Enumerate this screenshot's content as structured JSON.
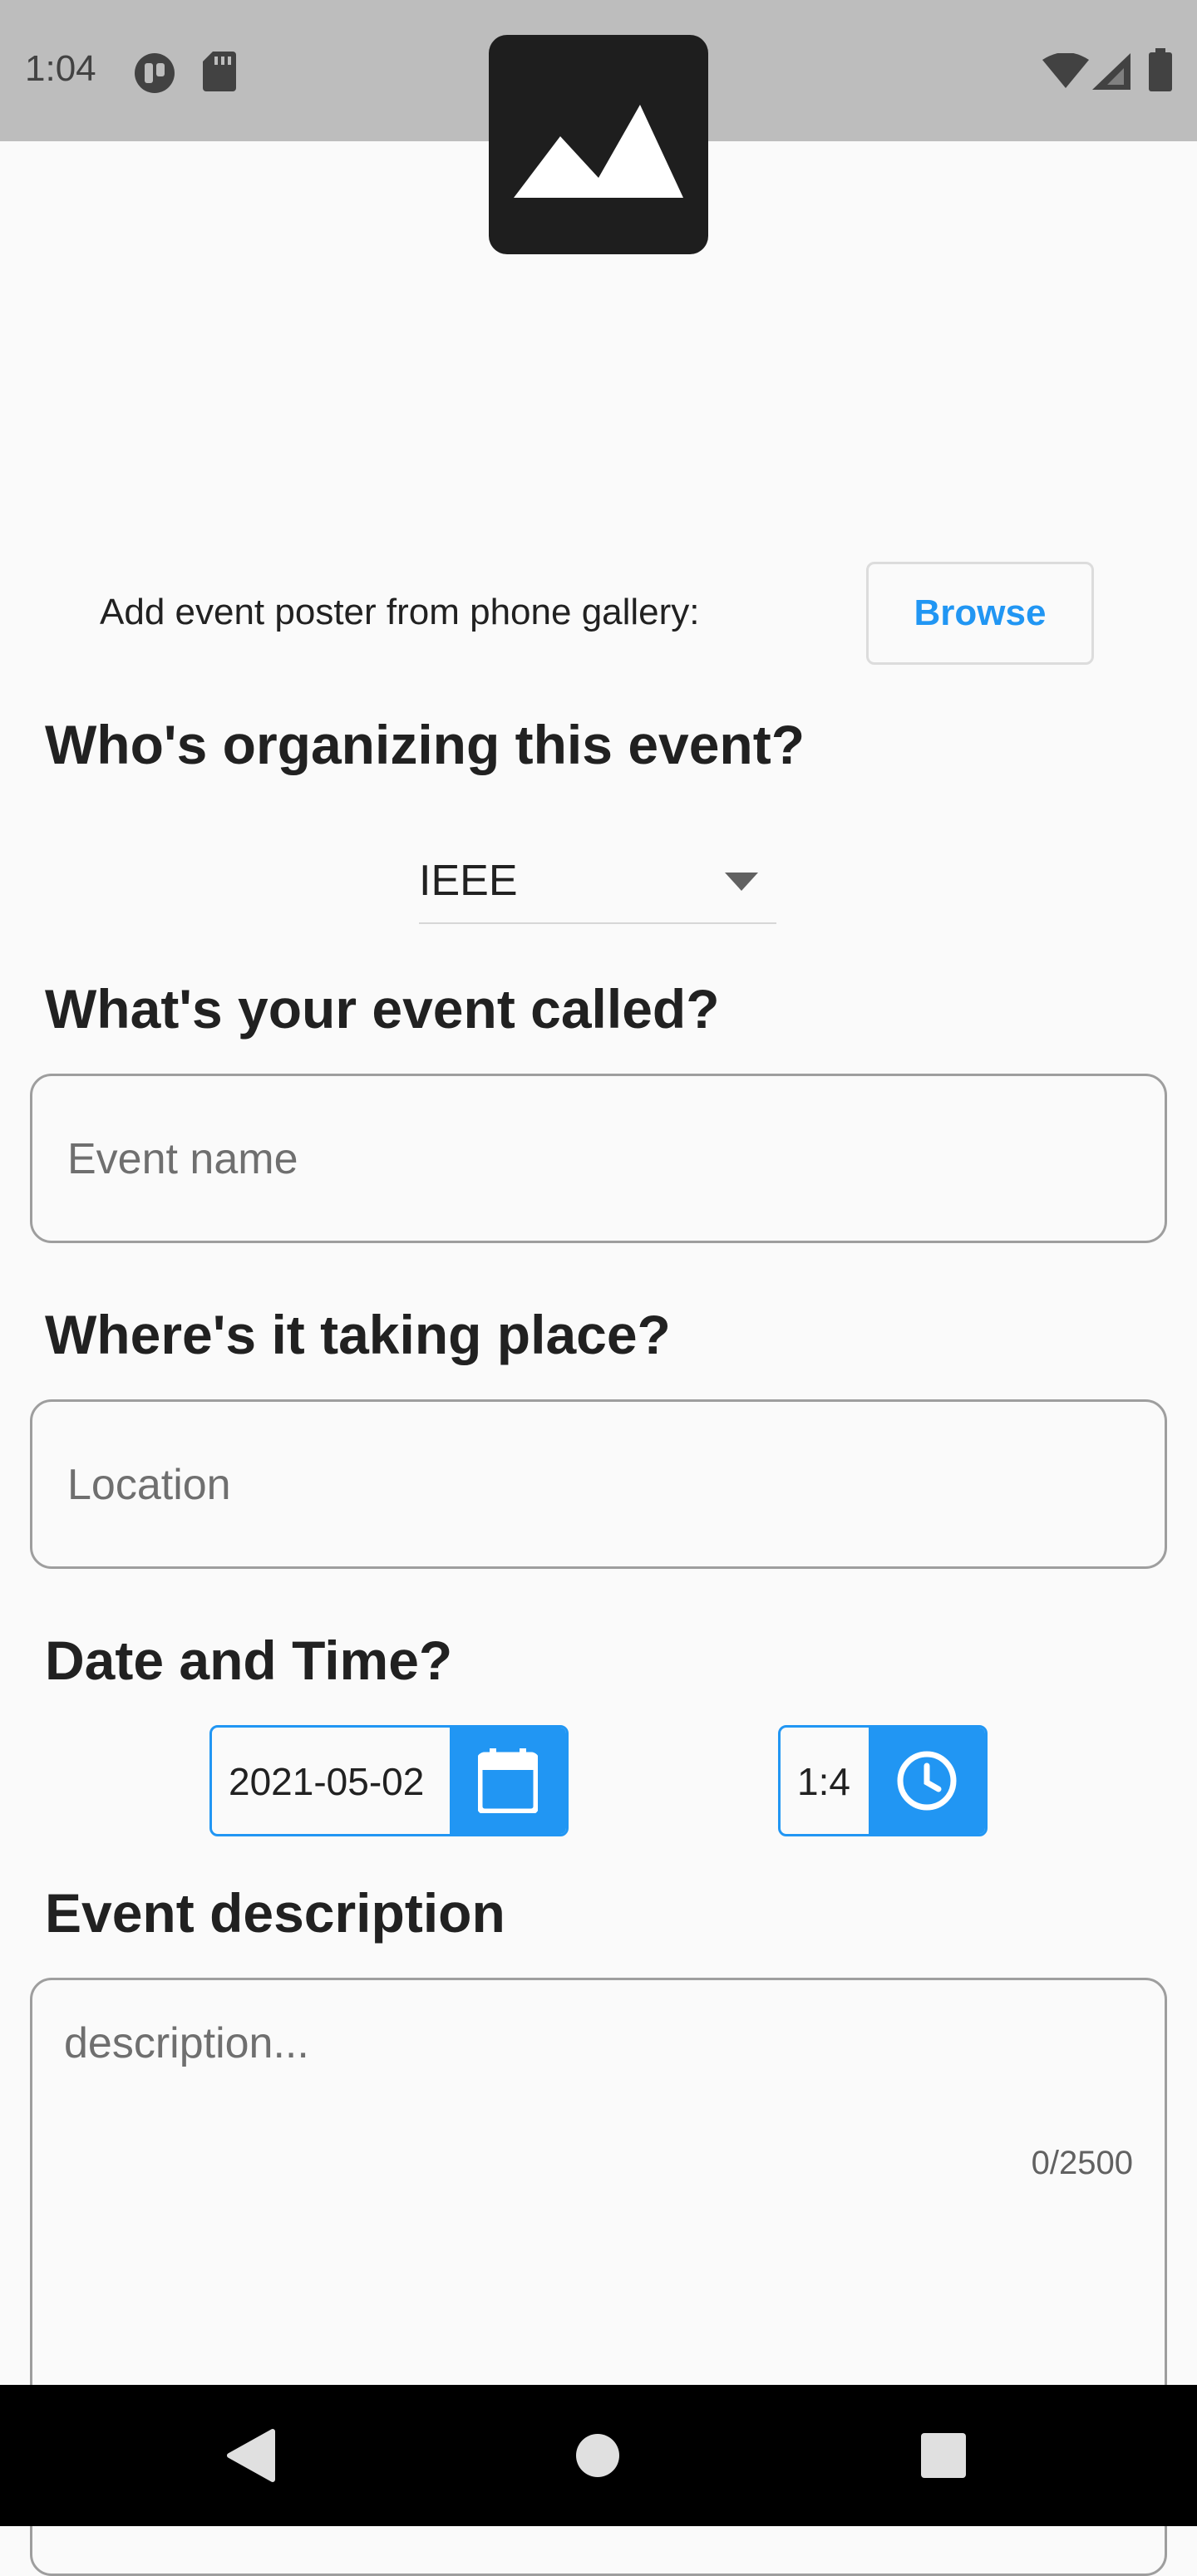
{
  "status_bar": {
    "time": "1:04",
    "icons": [
      "data-saver-icon",
      "sd-card-icon",
      "wifi-icon",
      "signal-icon",
      "battery-icon"
    ]
  },
  "poster": {
    "icon": "image-placeholder-icon",
    "label": "Add event poster from phone gallery:",
    "browse_label": "Browse"
  },
  "organizer": {
    "title": "Who's organizing this event?",
    "selected": "IEEE"
  },
  "event_name": {
    "title": "What's your event called?",
    "placeholder": "Event name"
  },
  "location": {
    "title": "Where's it taking place?",
    "placeholder": "Location"
  },
  "datetime": {
    "title": "Date and Time?",
    "date": "2021-05-02",
    "time": "1:4",
    "date_icon": "calendar-icon",
    "time_icon": "clock-icon"
  },
  "description": {
    "title": "Event description",
    "placeholder": "description...",
    "counter": "0/2500"
  },
  "nav_bar": {
    "icons": [
      "back-icon",
      "home-icon",
      "recents-icon"
    ]
  },
  "colors": {
    "accent": "#2196f3",
    "status_bar": "#bdbdbd",
    "background": "#fafafa"
  }
}
